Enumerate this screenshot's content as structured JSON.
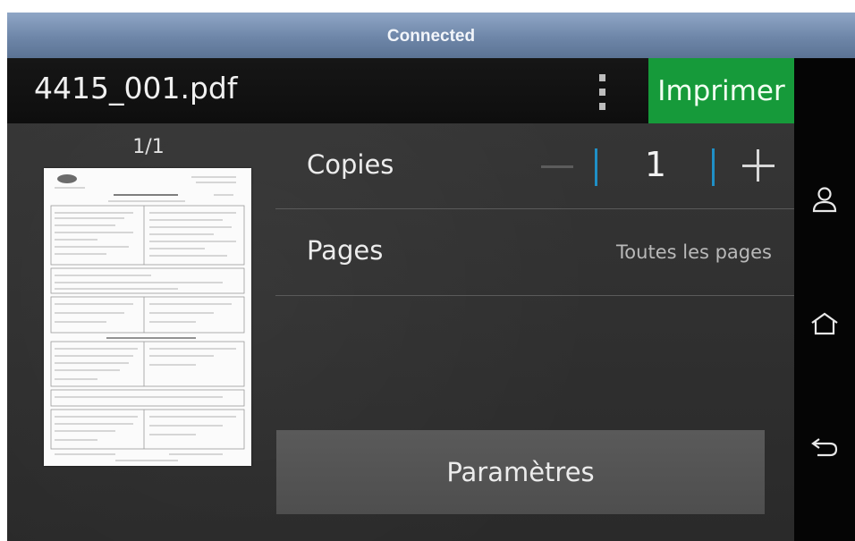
{
  "status_bar": {
    "text": "Connected"
  },
  "header": {
    "file_name": "4415_001.pdf",
    "menu_icon": "overflow-vertical-icon",
    "print_label": "Imprimer"
  },
  "preview": {
    "page_counter": "1/1"
  },
  "options": {
    "copies": {
      "label": "Copies",
      "value": "1",
      "minus_icon": "minus-icon",
      "plus_icon": "plus-icon"
    },
    "pages": {
      "label": "Pages",
      "value": "Toutes les pages"
    }
  },
  "settings_label": "Paramètres",
  "nav": {
    "items": [
      {
        "icon": "user-icon"
      },
      {
        "icon": "home-icon"
      },
      {
        "icon": "back-icon"
      }
    ]
  },
  "colors": {
    "status_bar": "#6e86a8",
    "print_button": "#169a3a",
    "stepper_separator": "#1f8fc6",
    "background": "#2e2e2e"
  }
}
